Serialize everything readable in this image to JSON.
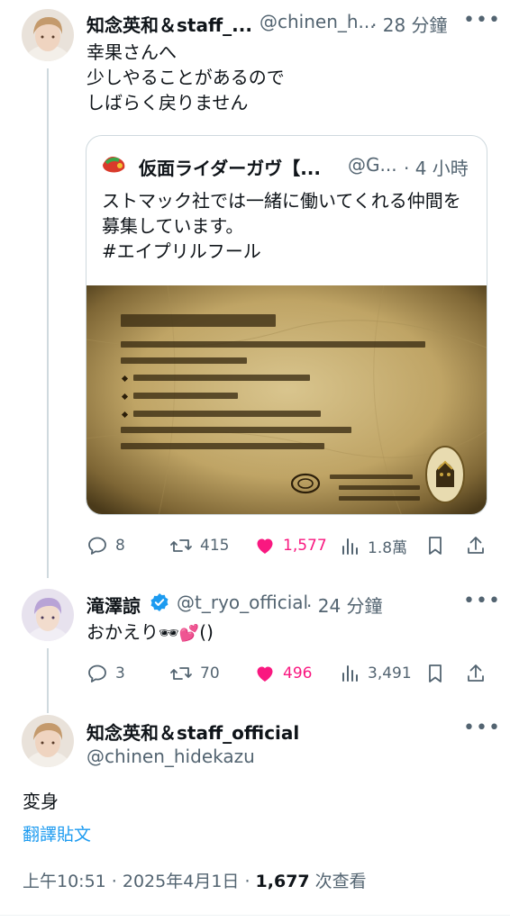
{
  "tweet1": {
    "author_name": "知念英和＆staff_...",
    "handle": "@chinen_h...",
    "time": "· 28 分鐘",
    "text_lines": [
      "幸果さんへ",
      "少しやることがあるので",
      "しばらく戻りません"
    ]
  },
  "quote": {
    "author_name": "仮面ライダーガヴ【...",
    "handle": "@G...",
    "time": "· 4 小時",
    "text_lines": [
      "ストマック社では一緒に働いてくれる仲間を",
      "募集しています。",
      "#エイプリルフール"
    ]
  },
  "tweet1_actions": {
    "replies": "8",
    "retweets": "415",
    "likes": "1,577",
    "views": "1.8萬"
  },
  "tweet2": {
    "author_name": "滝澤諒",
    "handle": "@t_ryo_official",
    "time": "· 24 分鐘",
    "text": "おかえり",
    "text_suffix": "()",
    "emoji_1": "🕶",
    "emoji_2": "💕"
  },
  "tweet2_actions": {
    "replies": "3",
    "retweets": "70",
    "likes": "496",
    "views": "3,491"
  },
  "main_tweet": {
    "author_name": "知念英和＆staff_official",
    "handle": "@chinen_hidekazu",
    "text": "変身",
    "translate_label": "翻譯貼文",
    "timestamp": "上午10:51 · 2025年4月1日 · ",
    "view_count": "1,677",
    "view_label": " 次查看"
  },
  "colors": {
    "like_pink": "#f91880",
    "link_blue": "#1d9bf0",
    "muted_gray": "#536471"
  },
  "icons": [
    "reply-icon",
    "retweet-icon",
    "heart-icon",
    "views-icon",
    "bookmark-icon",
    "share-icon",
    "verified-icon",
    "more-icon"
  ]
}
